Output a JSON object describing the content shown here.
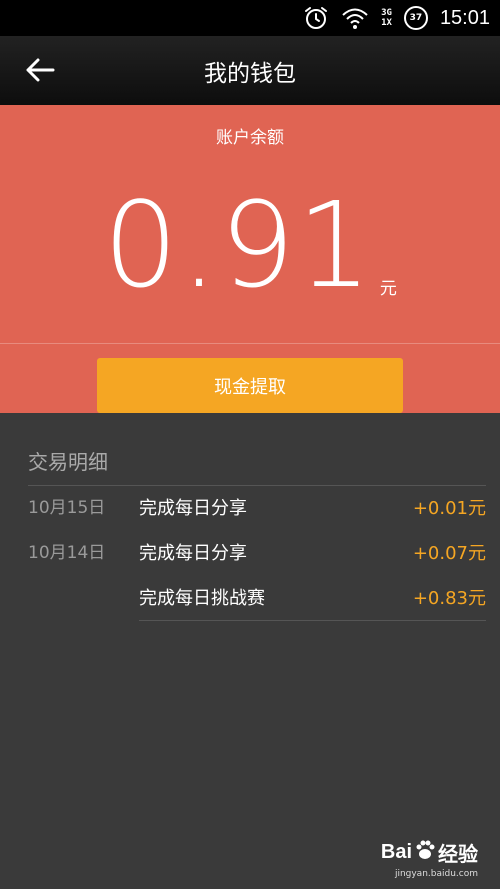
{
  "status_bar": {
    "time": "15:01",
    "net_top": "3G",
    "net_bottom": "1X",
    "battery": "37"
  },
  "header": {
    "title": "我的钱包"
  },
  "balance": {
    "label": "账户余额",
    "value": "0.91",
    "unit": "元",
    "withdraw_label": "现金提取"
  },
  "transactions": {
    "heading": "交易明细",
    "items": [
      {
        "date": "10月15日",
        "desc": "完成每日分享",
        "amount": "+0.01元"
      },
      {
        "date": "10月14日",
        "desc": "完成每日分享",
        "amount": "+0.07元"
      },
      {
        "date": "",
        "desc": "完成每日挑战赛",
        "amount": "+0.83元"
      }
    ]
  },
  "watermark": {
    "logo_left": "Bai",
    "logo_right": "经验",
    "sub": "jingyan.baidu.com"
  },
  "colors": {
    "balance_bg": "#e06453",
    "button": "#f5a623",
    "amount": "#f5a623",
    "list_bg": "#3a3a3a"
  }
}
